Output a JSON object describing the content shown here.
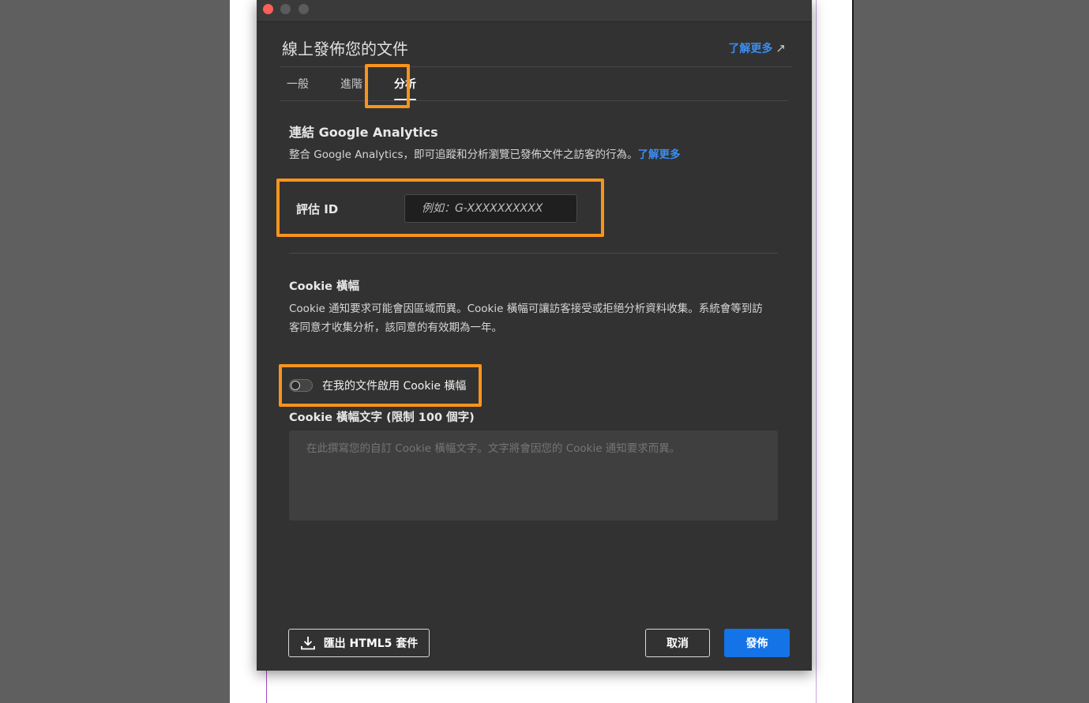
{
  "dialog": {
    "title": "線上發佈您的文件",
    "learn_more_top": "了解更多",
    "learn_more_arrow_icon": "external-link-icon"
  },
  "tabs": [
    {
      "label": "一般",
      "active": false
    },
    {
      "label": "進階",
      "active": false
    },
    {
      "label": "分析",
      "active": true
    }
  ],
  "analytics": {
    "title": "連結 Google Analytics",
    "description": "整合 Google Analytics，即可追蹤和分析瀏覽已發佈文件之訪客的行為。",
    "learn_more": "了解更多",
    "measurement_id_label": "評估 ID",
    "measurement_id_placeholder": "例如：G-XXXXXXXXXX",
    "measurement_id_value": ""
  },
  "cookie": {
    "title": "Cookie 橫幅",
    "description_line1": "Cookie 通知要求可能會因區域而異。Cookie 橫幅可讓訪客接受或拒絕分析資料收集。系統會等到訪",
    "description_line2": "客同意才收集分析，該同意的有效期為一年。",
    "toggle_label": "在我的文件啟用 Cookie 橫幅",
    "toggle_on": false,
    "text_label": "Cookie 橫幅文字 (限制 100 個字)",
    "text_placeholder": "在此撰寫您的自訂 Cookie 橫幅文字。文字將會因您的 Cookie 通知要求而異。"
  },
  "buttons": {
    "export": "匯出 HTML5 套件",
    "export_icon": "download-icon",
    "cancel": "取消",
    "publish": "發佈"
  },
  "colors": {
    "accent": "#1473e6",
    "link": "#3a8ef2",
    "highlight": "#f7941d",
    "dialog_bg": "#323232"
  }
}
